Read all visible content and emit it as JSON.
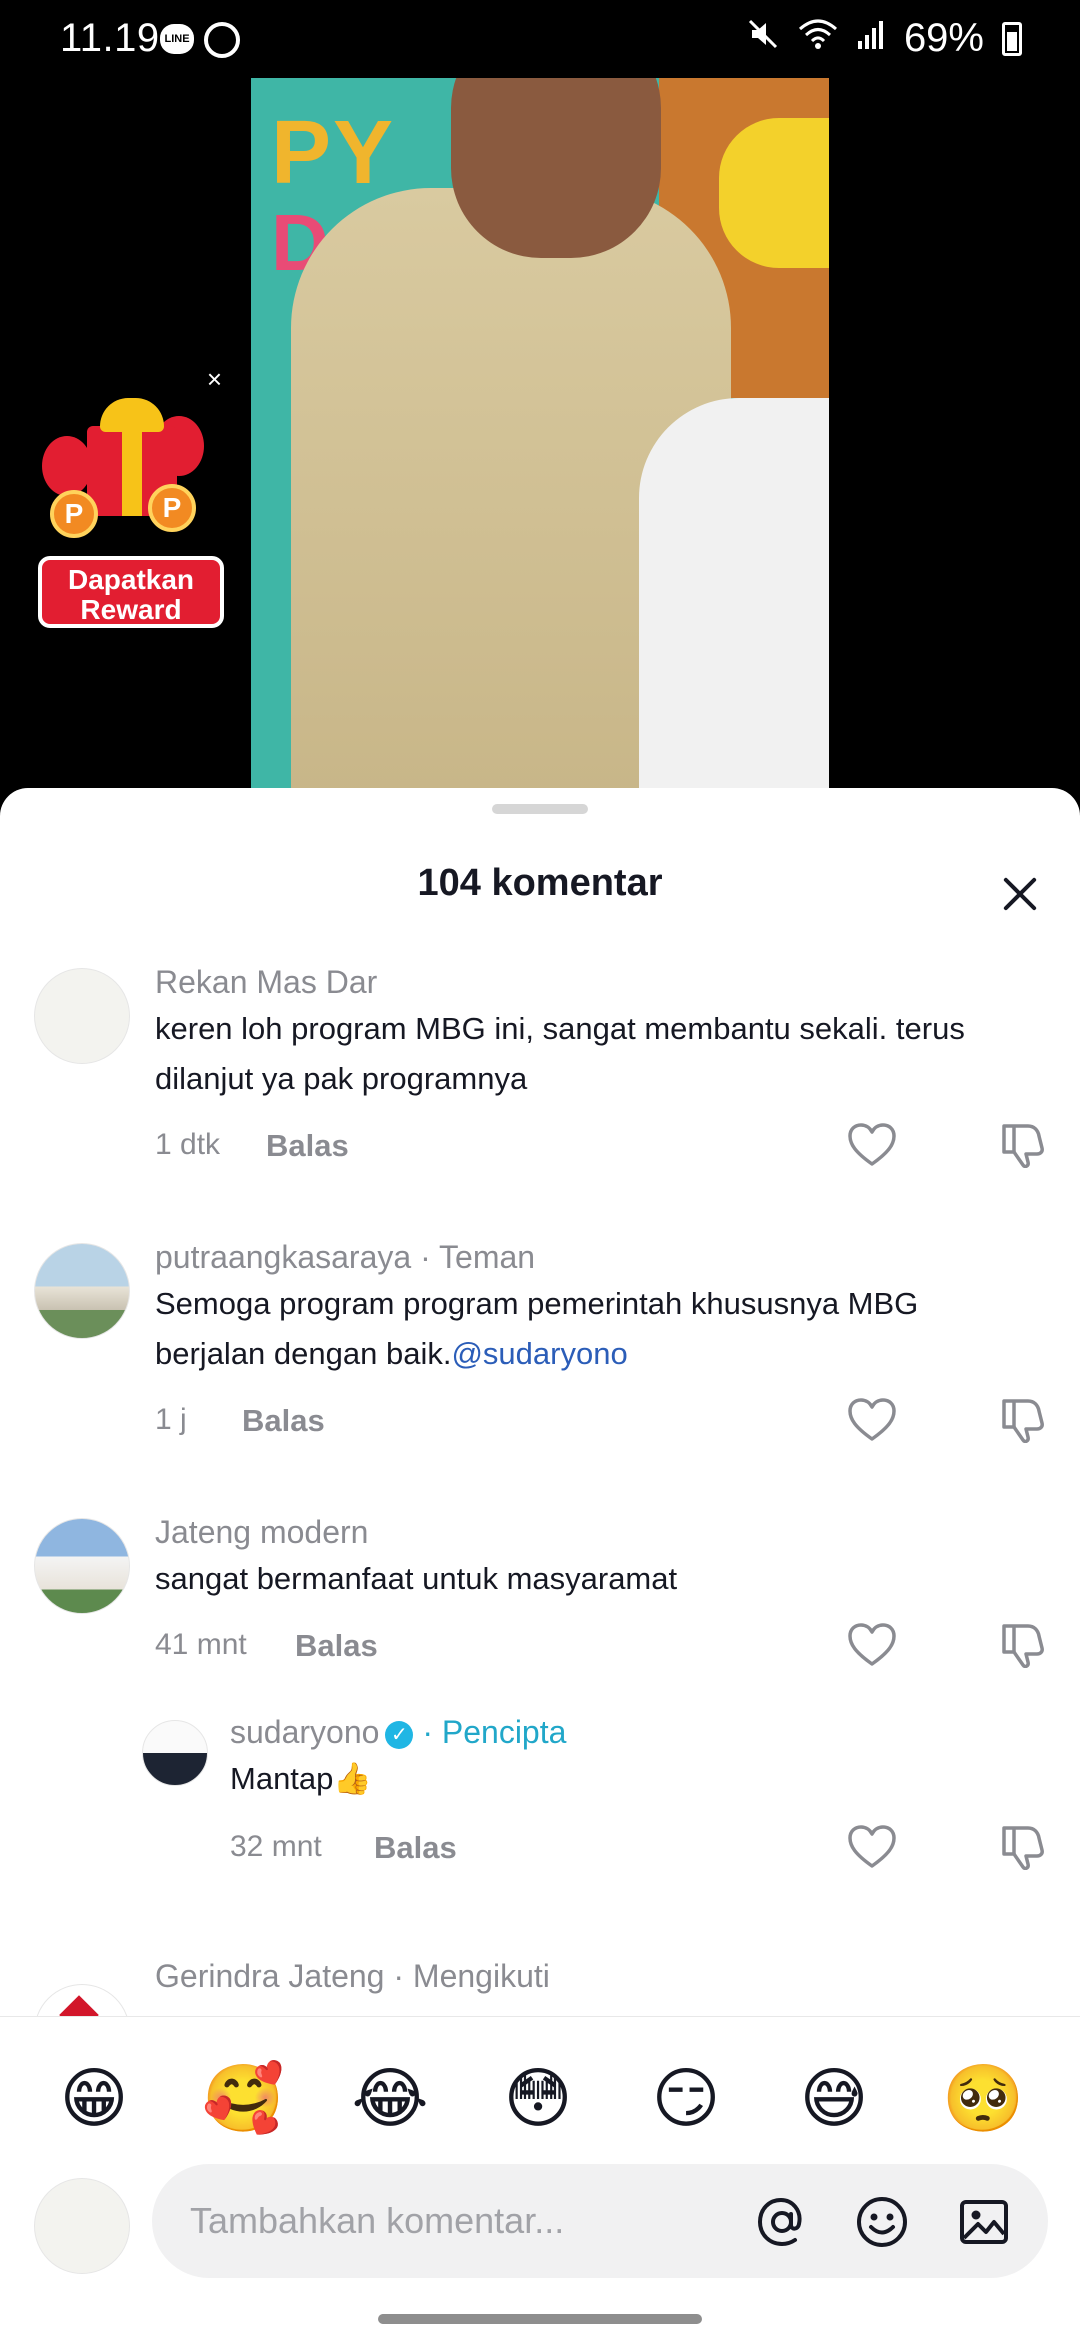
{
  "status_bar": {
    "time": "11.19",
    "battery": "69%",
    "icons": [
      "line-icon",
      "whatsapp-icon",
      "mute-icon",
      "wifi-icon",
      "signal-icon",
      "battery-icon"
    ]
  },
  "video": {
    "letters_top": "PY",
    "letters_bottom": "D",
    "reward": {
      "label_line1": "Dapatkan",
      "label_line2": "Reward",
      "close": "×"
    }
  },
  "sheet": {
    "title": "104 komentar"
  },
  "comments": [
    {
      "name": "Rekan Mas Dar",
      "text": "keren loh program MBG ini, sangat membantu sekali. terus dilanjut ya pak programnya",
      "time": "1 dtk",
      "reply": "Balas"
    },
    {
      "name": "putraangkasaraya",
      "tag": "· Teman",
      "text": "Semoga program program pemerintah khususnya MBG berjalan dengan baik.",
      "mention": "@sudaryono",
      "time": "1 j",
      "reply": "Balas"
    },
    {
      "name": "Jateng modern",
      "text": "sangat bermanfaat untuk masyaramat",
      "time": "41 mnt",
      "reply": "Balas"
    },
    {
      "name": "sudaryono",
      "tag": "· Pencipta",
      "text": "Mantap👍",
      "time": "32 mnt",
      "reply": "Balas"
    },
    {
      "name": "Gerindra Jateng",
      "tag": "· Mengikuti"
    }
  ],
  "emojis": [
    "😁",
    "🥰",
    "😂",
    "😳",
    "😏",
    "😅",
    "🥺"
  ],
  "input": {
    "placeholder": "Tambahkan komentar..."
  },
  "colors": {
    "accent_creator": "#21a7c9",
    "mention": "#2b5db8",
    "muted": "#8a8b91",
    "reward_red": "#e21e31"
  }
}
